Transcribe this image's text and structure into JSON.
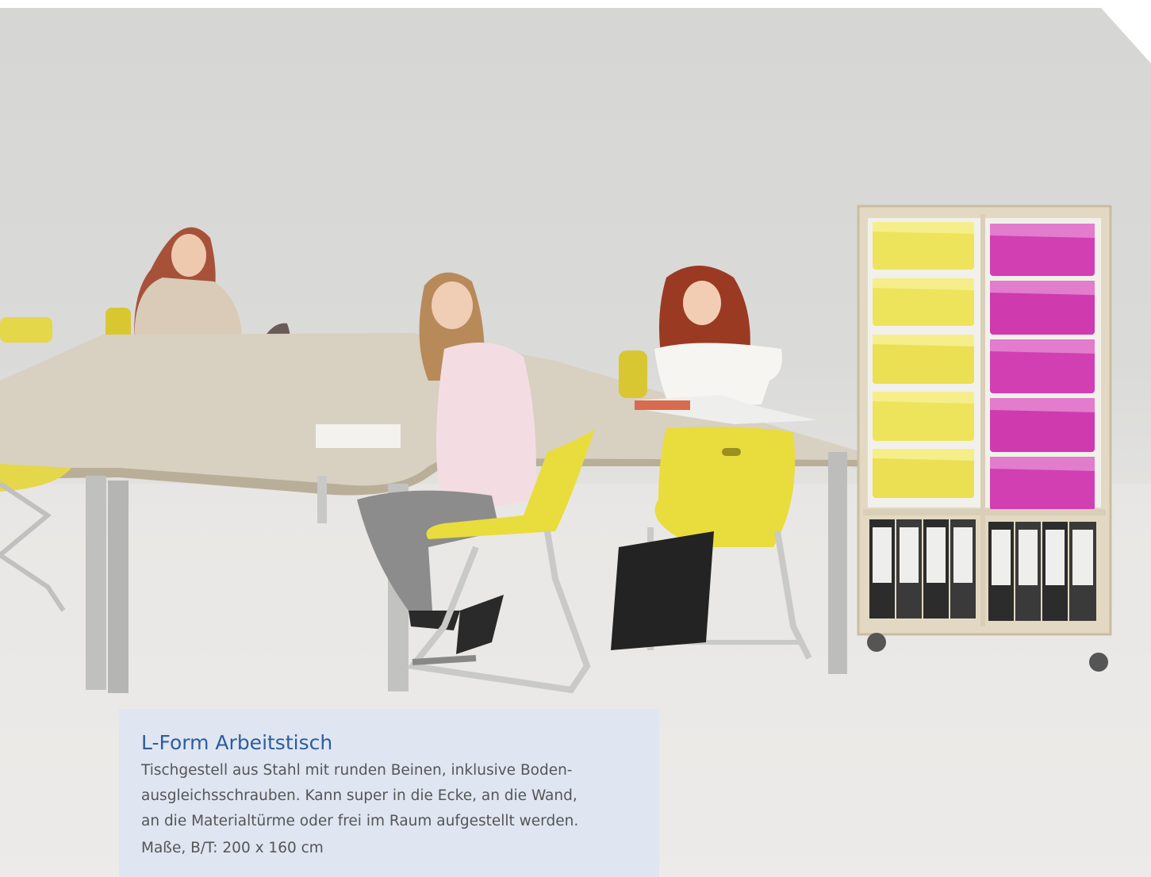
{
  "caption": {
    "title": "L-Form Arbeitstisch",
    "description": "Tischgestell aus Stahl mit runden Beinen, inklusive Boden-ausgleichsschrauben. Kann super in die Ecke, an die Wand, an die Materialtürme oder frei im Raum aufgestellt werden.",
    "description_lines": [
      "Tischgestell aus Stahl mit runden Beinen, inklusive Boden-",
      "ausgleichsschrauben. Kann super in die Ecke, an die Wand,",
      "an die Materialtürme oder frei im Raum aufgestellt werden."
    ],
    "dimensions": "Maße, B/T: 200 x 160 cm"
  },
  "colors": {
    "title_blue": "#2d5d9c",
    "caption_bg": "#dfe6f2",
    "bin_yellow": "#eee45c",
    "bin_magenta": "#d23fb2",
    "chair_yellow": "#e9dc3d"
  }
}
